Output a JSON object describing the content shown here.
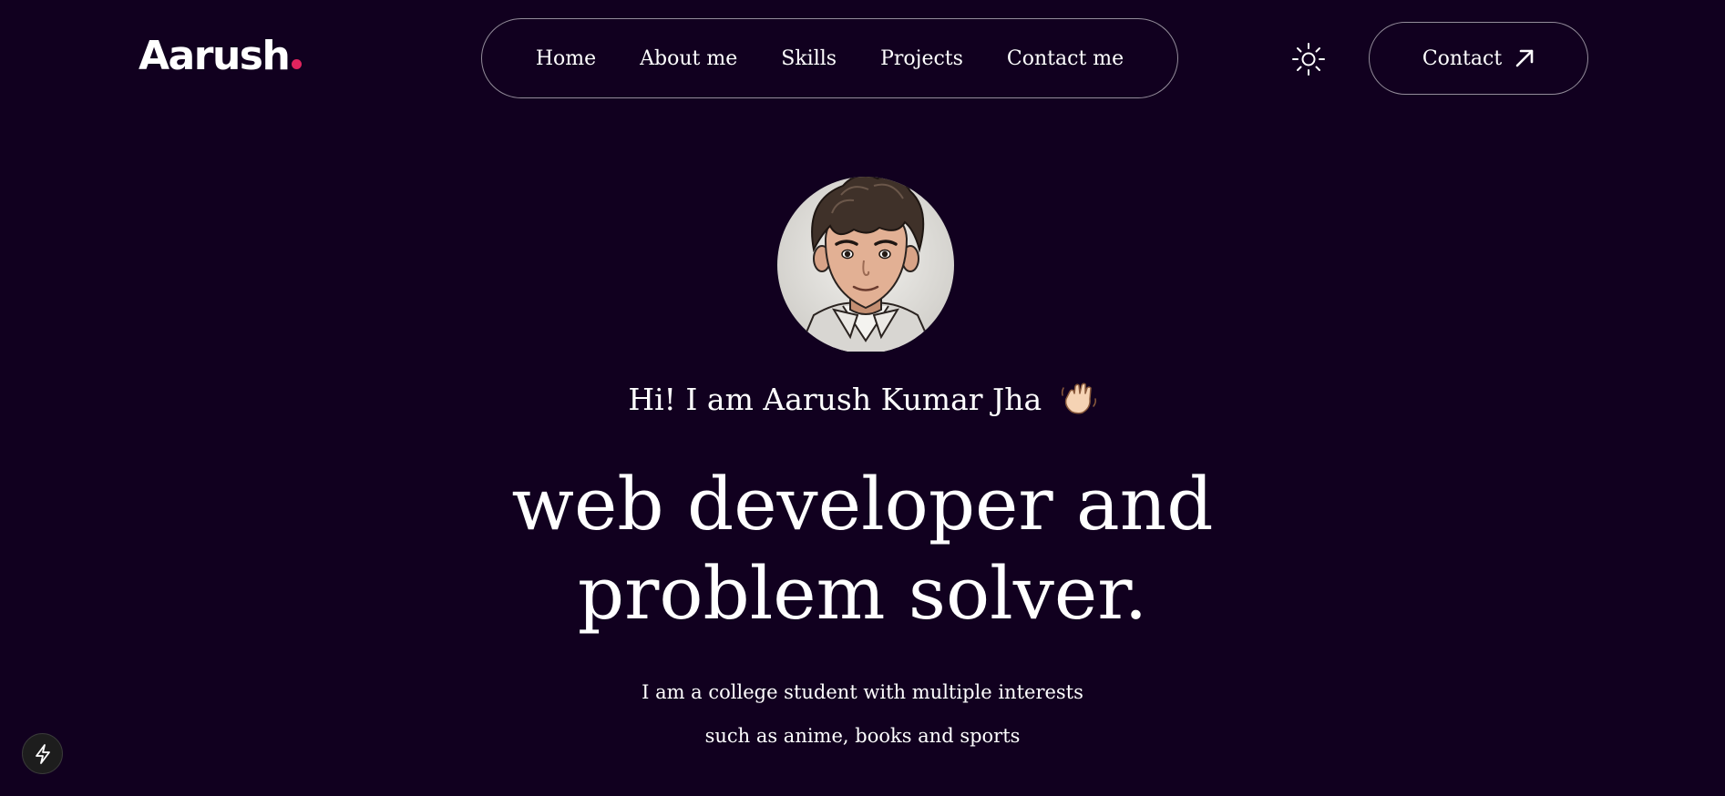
{
  "header": {
    "logo_text": "Aarush",
    "logo_dot_color": "#e0245e",
    "nav": [
      {
        "label": "Home"
      },
      {
        "label": "About me"
      },
      {
        "label": "Skills"
      },
      {
        "label": "Projects"
      },
      {
        "label": "Contact me"
      }
    ],
    "theme_toggle_icon": "sun-icon",
    "contact_button": {
      "label": "Contact",
      "icon": "arrow-up-right-icon"
    }
  },
  "hero": {
    "avatar_icon": "profile-avatar",
    "greeting": "Hi! I am Aarush Kumar Jha",
    "greeting_icon": "waving-hand-icon",
    "headline_line1": "web developer and",
    "headline_line2": "problem solver.",
    "intro_line1": "I am a college student with multiple interests",
    "intro_line2": "such as anime, books and sports"
  },
  "badge": {
    "icon": "lightning-bolt-icon"
  },
  "colors": {
    "background": "#11001f",
    "text": "#ffffff",
    "accent": "#e0245e"
  }
}
